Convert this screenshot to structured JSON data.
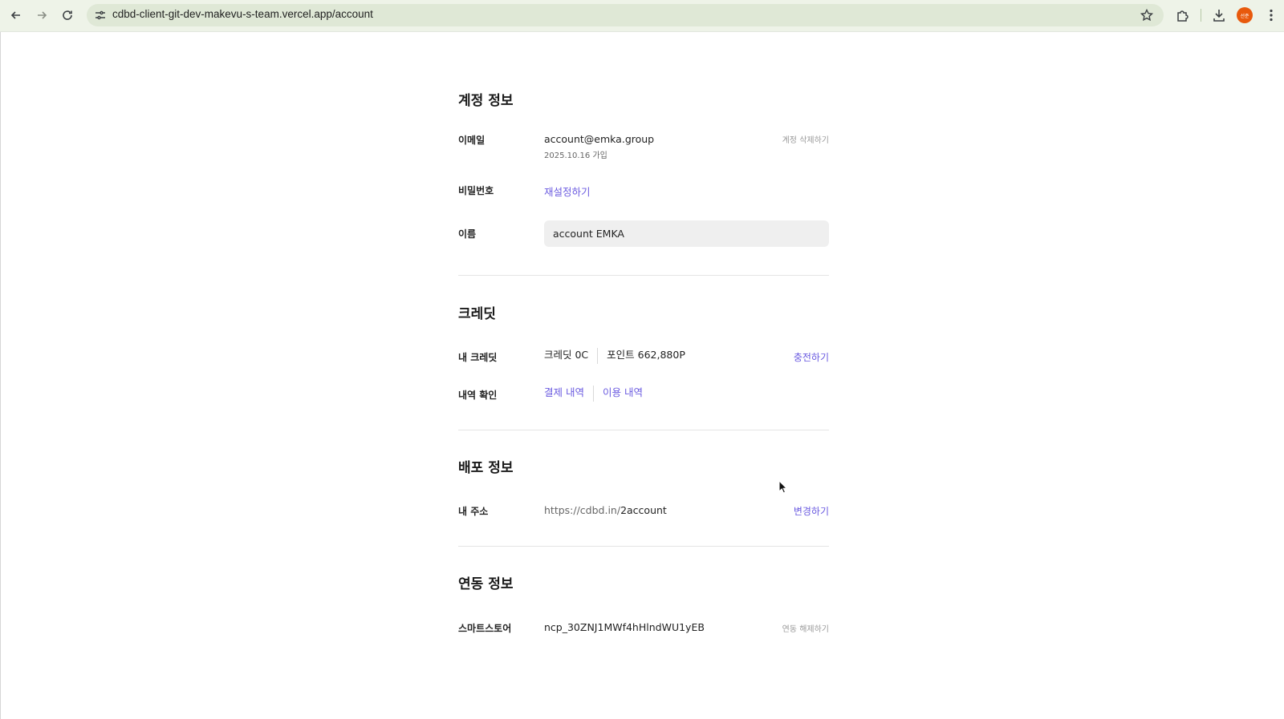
{
  "browser": {
    "url": "cdbd-client-git-dev-makevu-s-team.vercel.app/account",
    "avatar_text": "선준"
  },
  "account": {
    "title": "계정 정보",
    "email_label": "이메일",
    "email": "account@emka.group",
    "joined": "2025.10.16 가입",
    "delete_account": "계정 삭제하기",
    "password_label": "비밀번호",
    "password_reset": "재설정하기",
    "name_label": "이름",
    "name_value": "account EMKA"
  },
  "credit": {
    "title": "크레딧",
    "my_credit_label": "내 크레딧",
    "credit_value": "크레딧 0C",
    "point_value": "포인트 662,880P",
    "charge": "충전하기",
    "history_label": "내역 확인",
    "payment_history": "결제 내역",
    "usage_history": "이용 내역"
  },
  "deploy": {
    "title": "배포 정보",
    "address_label": "내 주소",
    "address_prefix": "https://cdbd.in/",
    "address_slug": "2account",
    "change": "변경하기"
  },
  "integration": {
    "title": "연동 정보",
    "store_label": "스마트스토어",
    "store_value": "ncp_30ZNJ1MWf4hHlndWU1yEB",
    "unlink": "연동 해제하기"
  },
  "colors": {
    "accent_link": "#6a5ae0",
    "chrome_bg": "#eef3e8",
    "avatar": "#e8590c"
  }
}
